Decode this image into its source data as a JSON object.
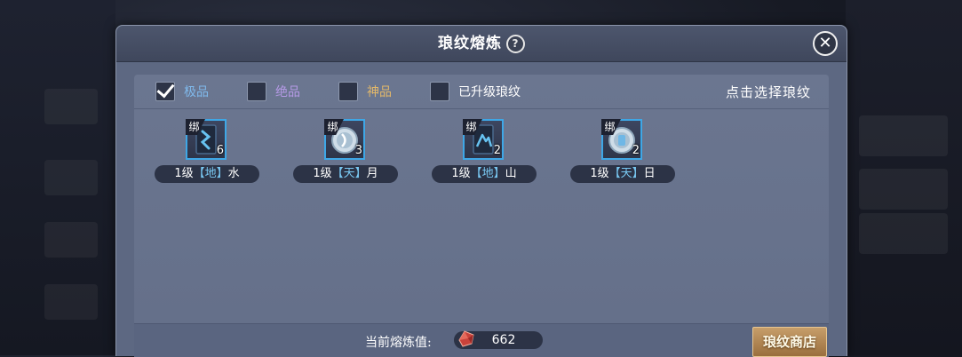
{
  "window": {
    "title": "琅纹熔炼",
    "help_symbol": "?",
    "close_symbol": "✕"
  },
  "filters": [
    {
      "label": "极品",
      "checked": true,
      "color": "#7fb9ec"
    },
    {
      "label": "绝品",
      "checked": false,
      "color": "#b59ae6"
    },
    {
      "label": "神品",
      "checked": false,
      "color": "#e2b86a"
    },
    {
      "label": "已升级琅纹",
      "checked": false,
      "color": "#ffffff"
    }
  ],
  "hint": "点击选择琅纹",
  "items": [
    {
      "bind_tag": "绑",
      "qty": "6",
      "level": "1级",
      "tier": "【地】",
      "name": "水",
      "icon": "water-rune-icon"
    },
    {
      "bind_tag": "绑",
      "qty": "3",
      "level": "1级",
      "tier": "【天】",
      "name": "月",
      "icon": "moon-rune-icon"
    },
    {
      "bind_tag": "绑",
      "qty": "2",
      "level": "1级",
      "tier": "【地】",
      "name": "山",
      "icon": "mountain-rune-icon"
    },
    {
      "bind_tag": "绑",
      "qty": "2",
      "level": "1级",
      "tier": "【天】",
      "name": "日",
      "icon": "sun-rune-icon"
    }
  ],
  "footer": {
    "value_label": "当前熔炼值:",
    "value": "662",
    "shop_button": "琅纹商店"
  },
  "colors": {
    "accent_border": "#3ea7e6",
    "tier_text": "#79c8f2",
    "shop_button": "#b88a55"
  }
}
